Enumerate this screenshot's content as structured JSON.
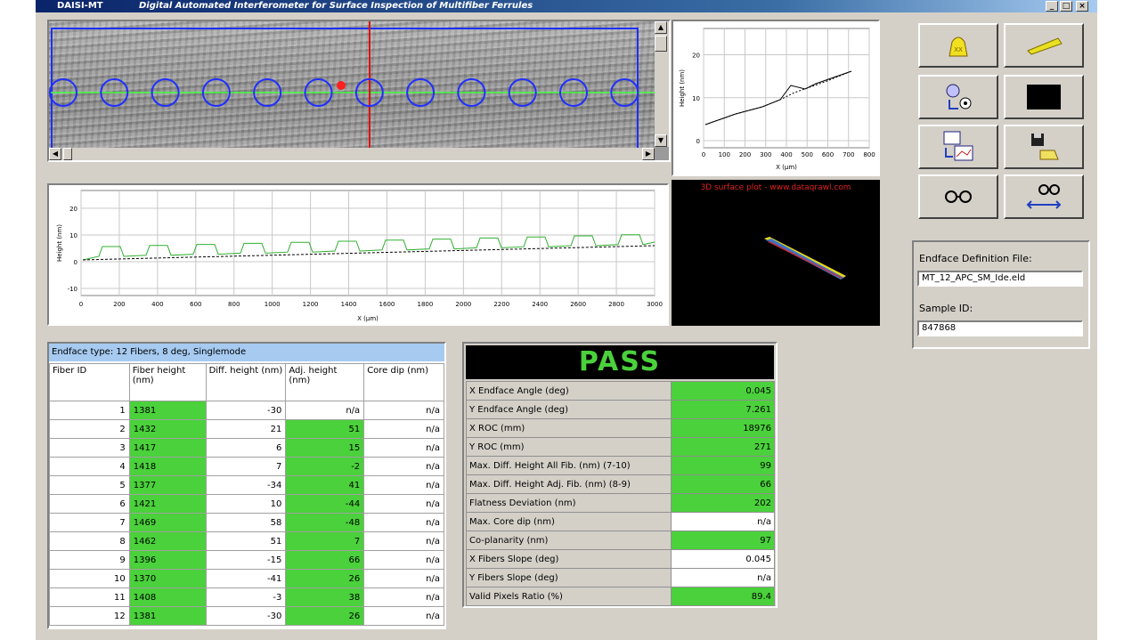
{
  "window": {
    "app_name": "DAISI-MT",
    "subtitle": "Digital Automated Interferometer for Surface Inspection of Multifiber Ferrules",
    "buttons": {
      "minimize": "_",
      "maximize": "□",
      "close": "×"
    }
  },
  "small_graph": {
    "ylabel": "Height (nm)",
    "xlabel": "X (µm)",
    "xticks": [
      "0",
      "100",
      "200",
      "300",
      "400",
      "500",
      "600",
      "700",
      "800"
    ],
    "yticks": [
      "0",
      "10",
      "20"
    ]
  },
  "plot3d": {
    "caption": "3D surface plot - www.dataqrawl.com"
  },
  "profile_graph": {
    "ylabel": "Height (nm)",
    "xlabel": "X (µm)",
    "xticks": [
      "0",
      "200",
      "400",
      "600",
      "800",
      "1000",
      "1200",
      "1400",
      "1600",
      "1800",
      "2000",
      "2200",
      "2400",
      "2600",
      "2800",
      "3000"
    ],
    "yticks": [
      "-10",
      "0",
      "10",
      "20"
    ]
  },
  "tool_buttons": [
    {
      "icon": "weight-icon"
    },
    {
      "icon": "ruler-icon"
    },
    {
      "icon": "settings-target-icon"
    },
    {
      "icon": "black-square-icon"
    },
    {
      "icon": "chart-transfer-icon"
    },
    {
      "icon": "save-open-icon"
    },
    {
      "icon": "glasses-icon"
    },
    {
      "icon": "glasses-swap-icon"
    }
  ],
  "file_info": {
    "endface_label": "Endface Definition File:",
    "endface_value": "MT_12_APC_SM_Ide.eld",
    "sample_label": "Sample ID:",
    "sample_value": "847868"
  },
  "fiber_table": {
    "endface_type": "Endface type: 12 Fibers, 8 deg, Singlemode",
    "headers": [
      "Fiber ID",
      "Fiber height (nm)",
      "Diff. height (nm)",
      "Adj. height (nm)",
      "Core dip (nm)"
    ],
    "rows": [
      {
        "id": "1",
        "height": "1381",
        "diff": "-30",
        "adj": "n/a",
        "core": "n/a",
        "adj_green": false
      },
      {
        "id": "2",
        "height": "1432",
        "diff": "21",
        "adj": "51",
        "core": "n/a",
        "adj_green": true
      },
      {
        "id": "3",
        "height": "1417",
        "diff": "6",
        "adj": "15",
        "core": "n/a",
        "adj_green": true
      },
      {
        "id": "4",
        "height": "1418",
        "diff": "7",
        "adj": "-2",
        "core": "n/a",
        "adj_green": true
      },
      {
        "id": "5",
        "height": "1377",
        "diff": "-34",
        "adj": "41",
        "core": "n/a",
        "adj_green": true
      },
      {
        "id": "6",
        "height": "1421",
        "diff": "10",
        "adj": "-44",
        "core": "n/a",
        "adj_green": true
      },
      {
        "id": "7",
        "height": "1469",
        "diff": "58",
        "adj": "-48",
        "core": "n/a",
        "adj_green": true
      },
      {
        "id": "8",
        "height": "1462",
        "diff": "51",
        "adj": "7",
        "core": "n/a",
        "adj_green": true
      },
      {
        "id": "9",
        "height": "1396",
        "diff": "-15",
        "adj": "66",
        "core": "n/a",
        "adj_green": true
      },
      {
        "id": "10",
        "height": "1370",
        "diff": "-41",
        "adj": "26",
        "core": "n/a",
        "adj_green": true
      },
      {
        "id": "11",
        "height": "1408",
        "diff": "-3",
        "adj": "38",
        "core": "n/a",
        "adj_green": true
      },
      {
        "id": "12",
        "height": "1381",
        "diff": "-30",
        "adj": "26",
        "core": "n/a",
        "adj_green": true
      }
    ]
  },
  "results": {
    "verdict": "PASS",
    "rows": [
      {
        "name": "X Endface Angle (deg)",
        "value": "0.045",
        "green": true
      },
      {
        "name": "Y Endface Angle (deg)",
        "value": "7.261",
        "green": true
      },
      {
        "name": "X ROC (mm)",
        "value": "18976",
        "green": true
      },
      {
        "name": "Y ROC (mm)",
        "value": "271",
        "green": true
      },
      {
        "name": "Max. Diff. Height All Fib. (nm) (7-10)",
        "value": "99",
        "green": true
      },
      {
        "name": "Max. Diff. Height Adj. Fib. (nm) (8-9)",
        "value": "66",
        "green": true
      },
      {
        "name": "Flatness Deviation (nm)",
        "value": "202",
        "green": true
      },
      {
        "name": "Max. Core dip (nm)",
        "value": "n/a",
        "green": false
      },
      {
        "name": "Co-planarity (nm)",
        "value": "97",
        "green": true
      },
      {
        "name": "X Fibers Slope (deg)",
        "value": "0.045",
        "green": false
      },
      {
        "name": "Y Fibers Slope (deg)",
        "value": "n/a",
        "green": false
      },
      {
        "name": "Valid Pixels Ratio (%)",
        "value": "89.4",
        "green": true
      }
    ]
  }
}
